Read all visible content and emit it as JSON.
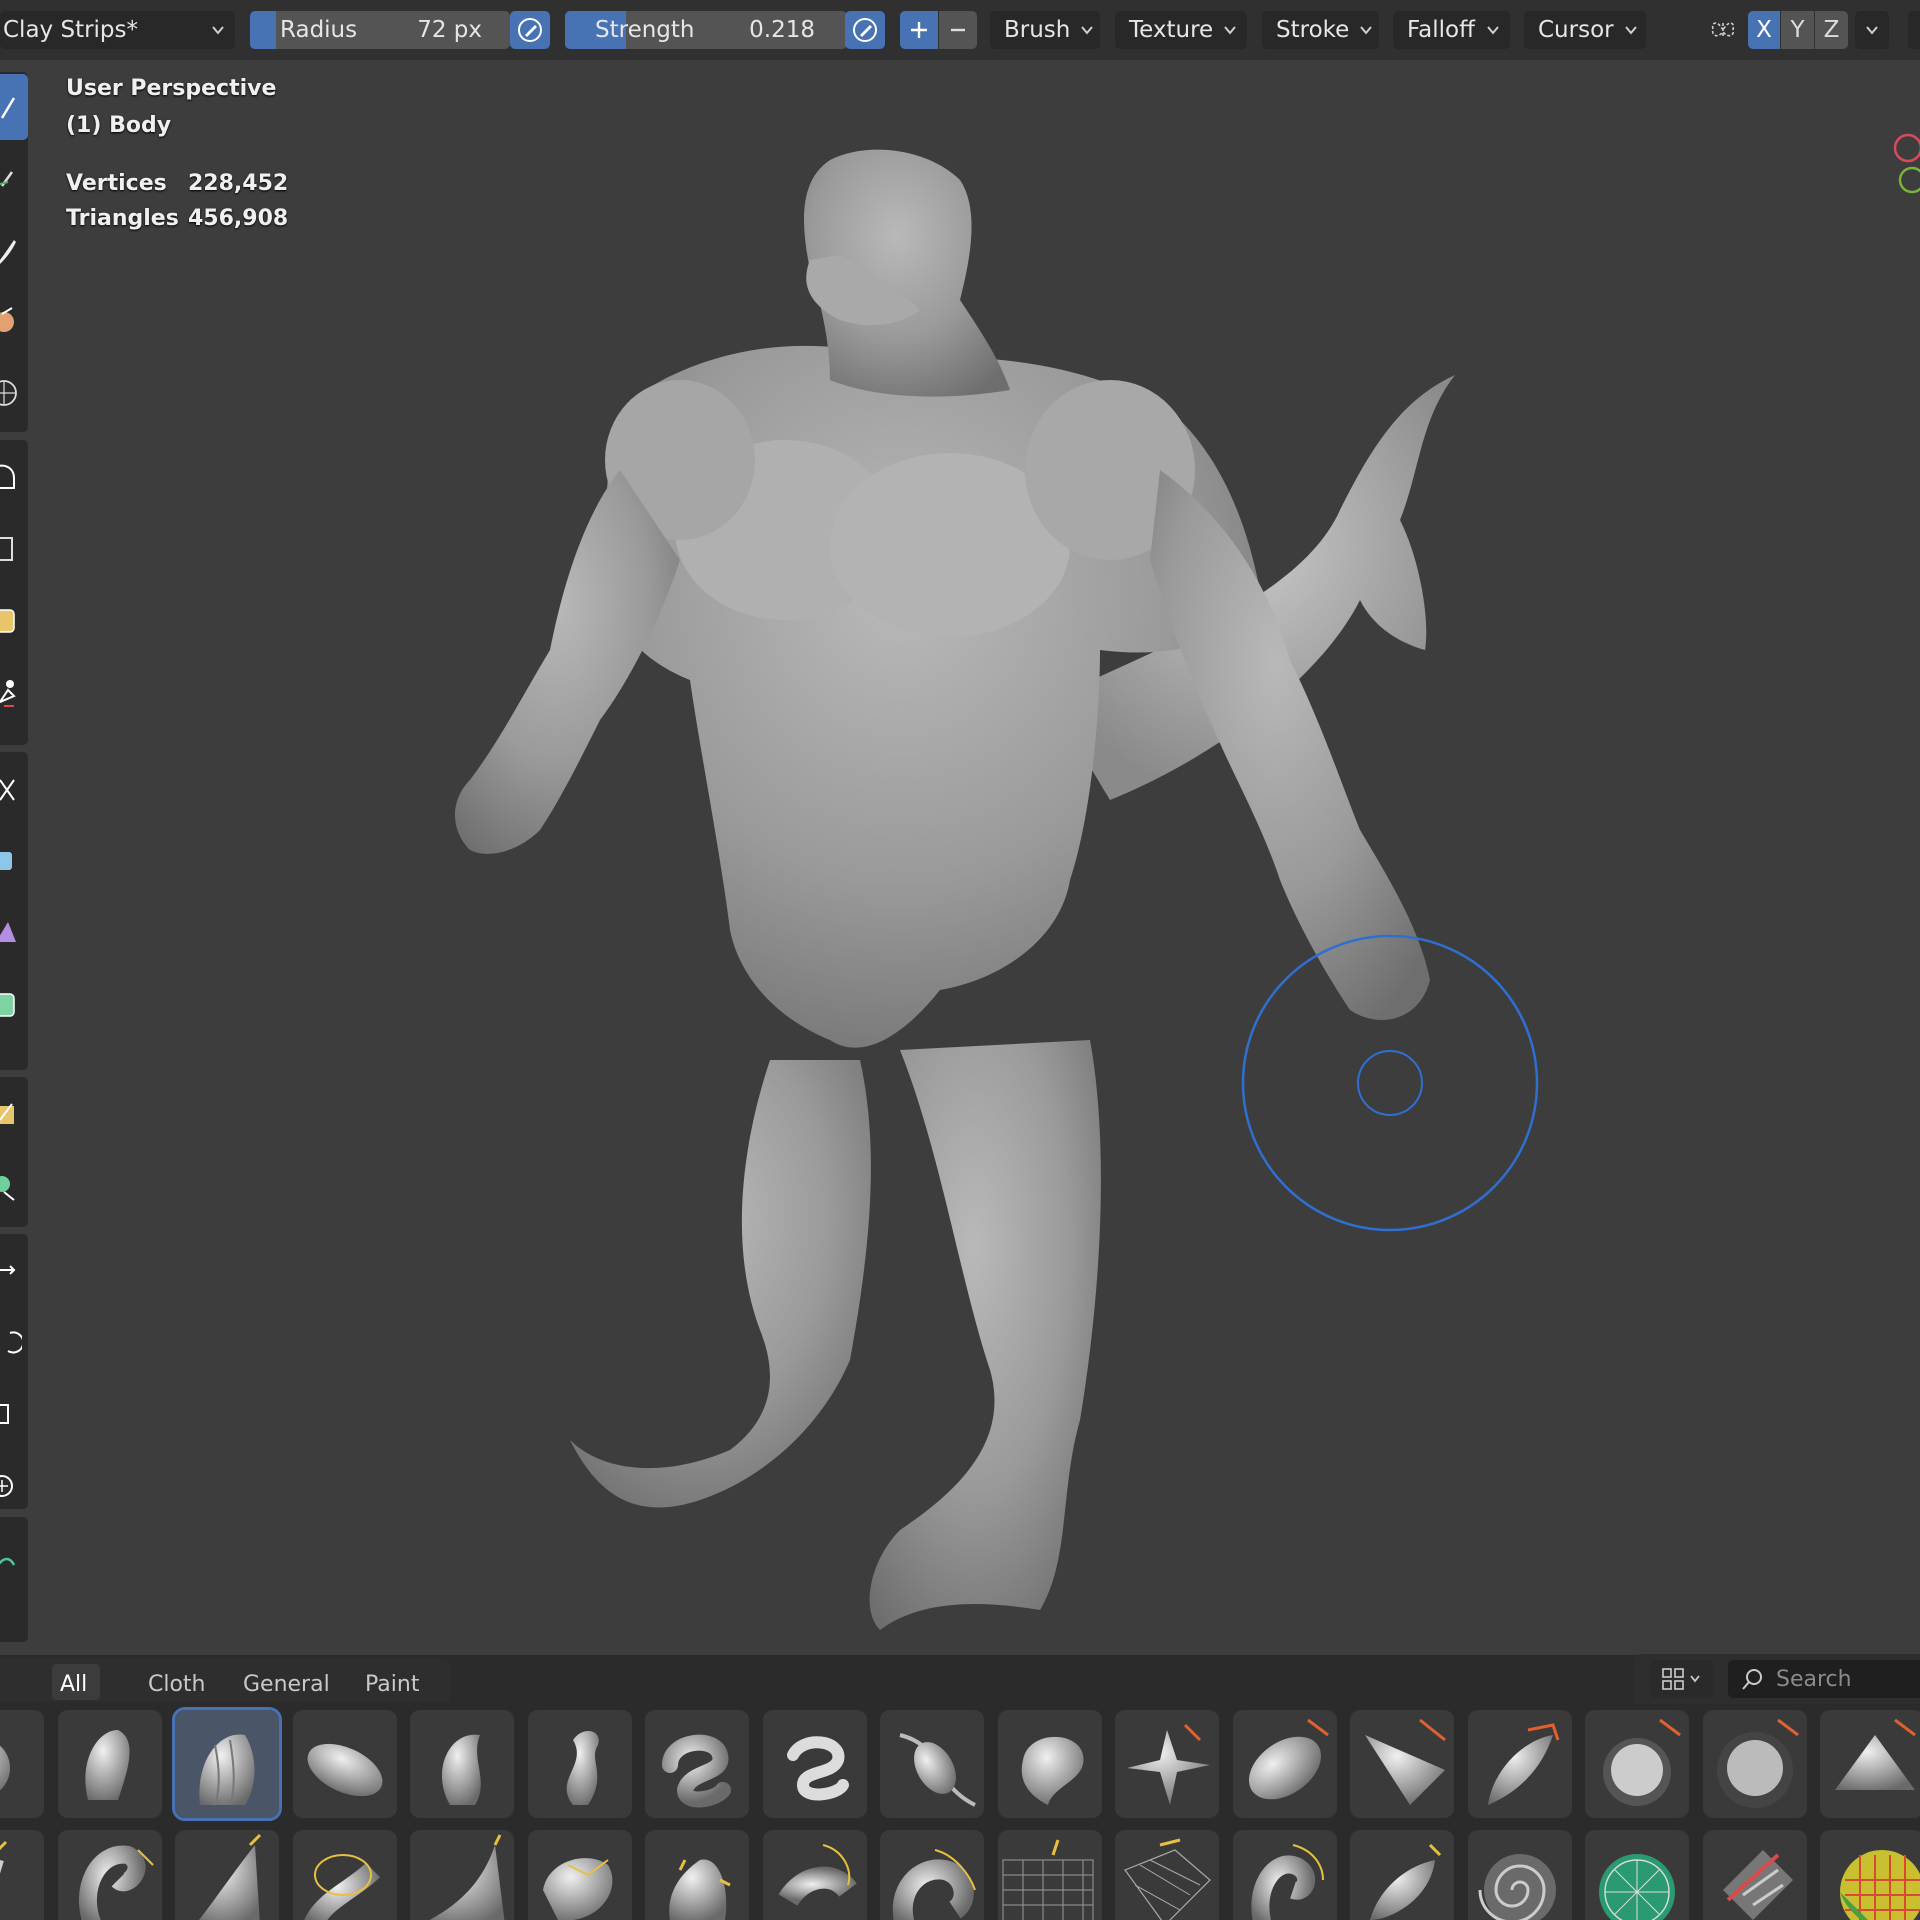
{
  "header": {
    "brush_name": "Clay Strips*",
    "radius": {
      "label": "Radius",
      "value": "72 px",
      "fill_fraction": 0.1
    },
    "strength": {
      "label": "Strength",
      "value": "0.218",
      "fill_fraction": 0.218
    },
    "menus": [
      "Brush",
      "Texture",
      "Stroke",
      "Falloff",
      "Cursor"
    ],
    "axes": [
      "X",
      "Y",
      "Z"
    ]
  },
  "viewport": {
    "view_name": "User Perspective",
    "object_name": "(1) Body",
    "stats": [
      {
        "label": "Vertices",
        "value": "228,452"
      },
      {
        "label": "Triangles",
        "value": "456,908"
      }
    ]
  },
  "asset_shelf": {
    "tabs": [
      "All",
      "Cloth",
      "General",
      "Paint"
    ],
    "active_tab": "All",
    "search_placeholder": "Search",
    "selected_brush_index": 2
  },
  "colors": {
    "accent": "#4772b3",
    "header_bg": "#303030",
    "viewport_bg": "#3d3d3d",
    "brush_cursor": "#2f6fd0"
  }
}
